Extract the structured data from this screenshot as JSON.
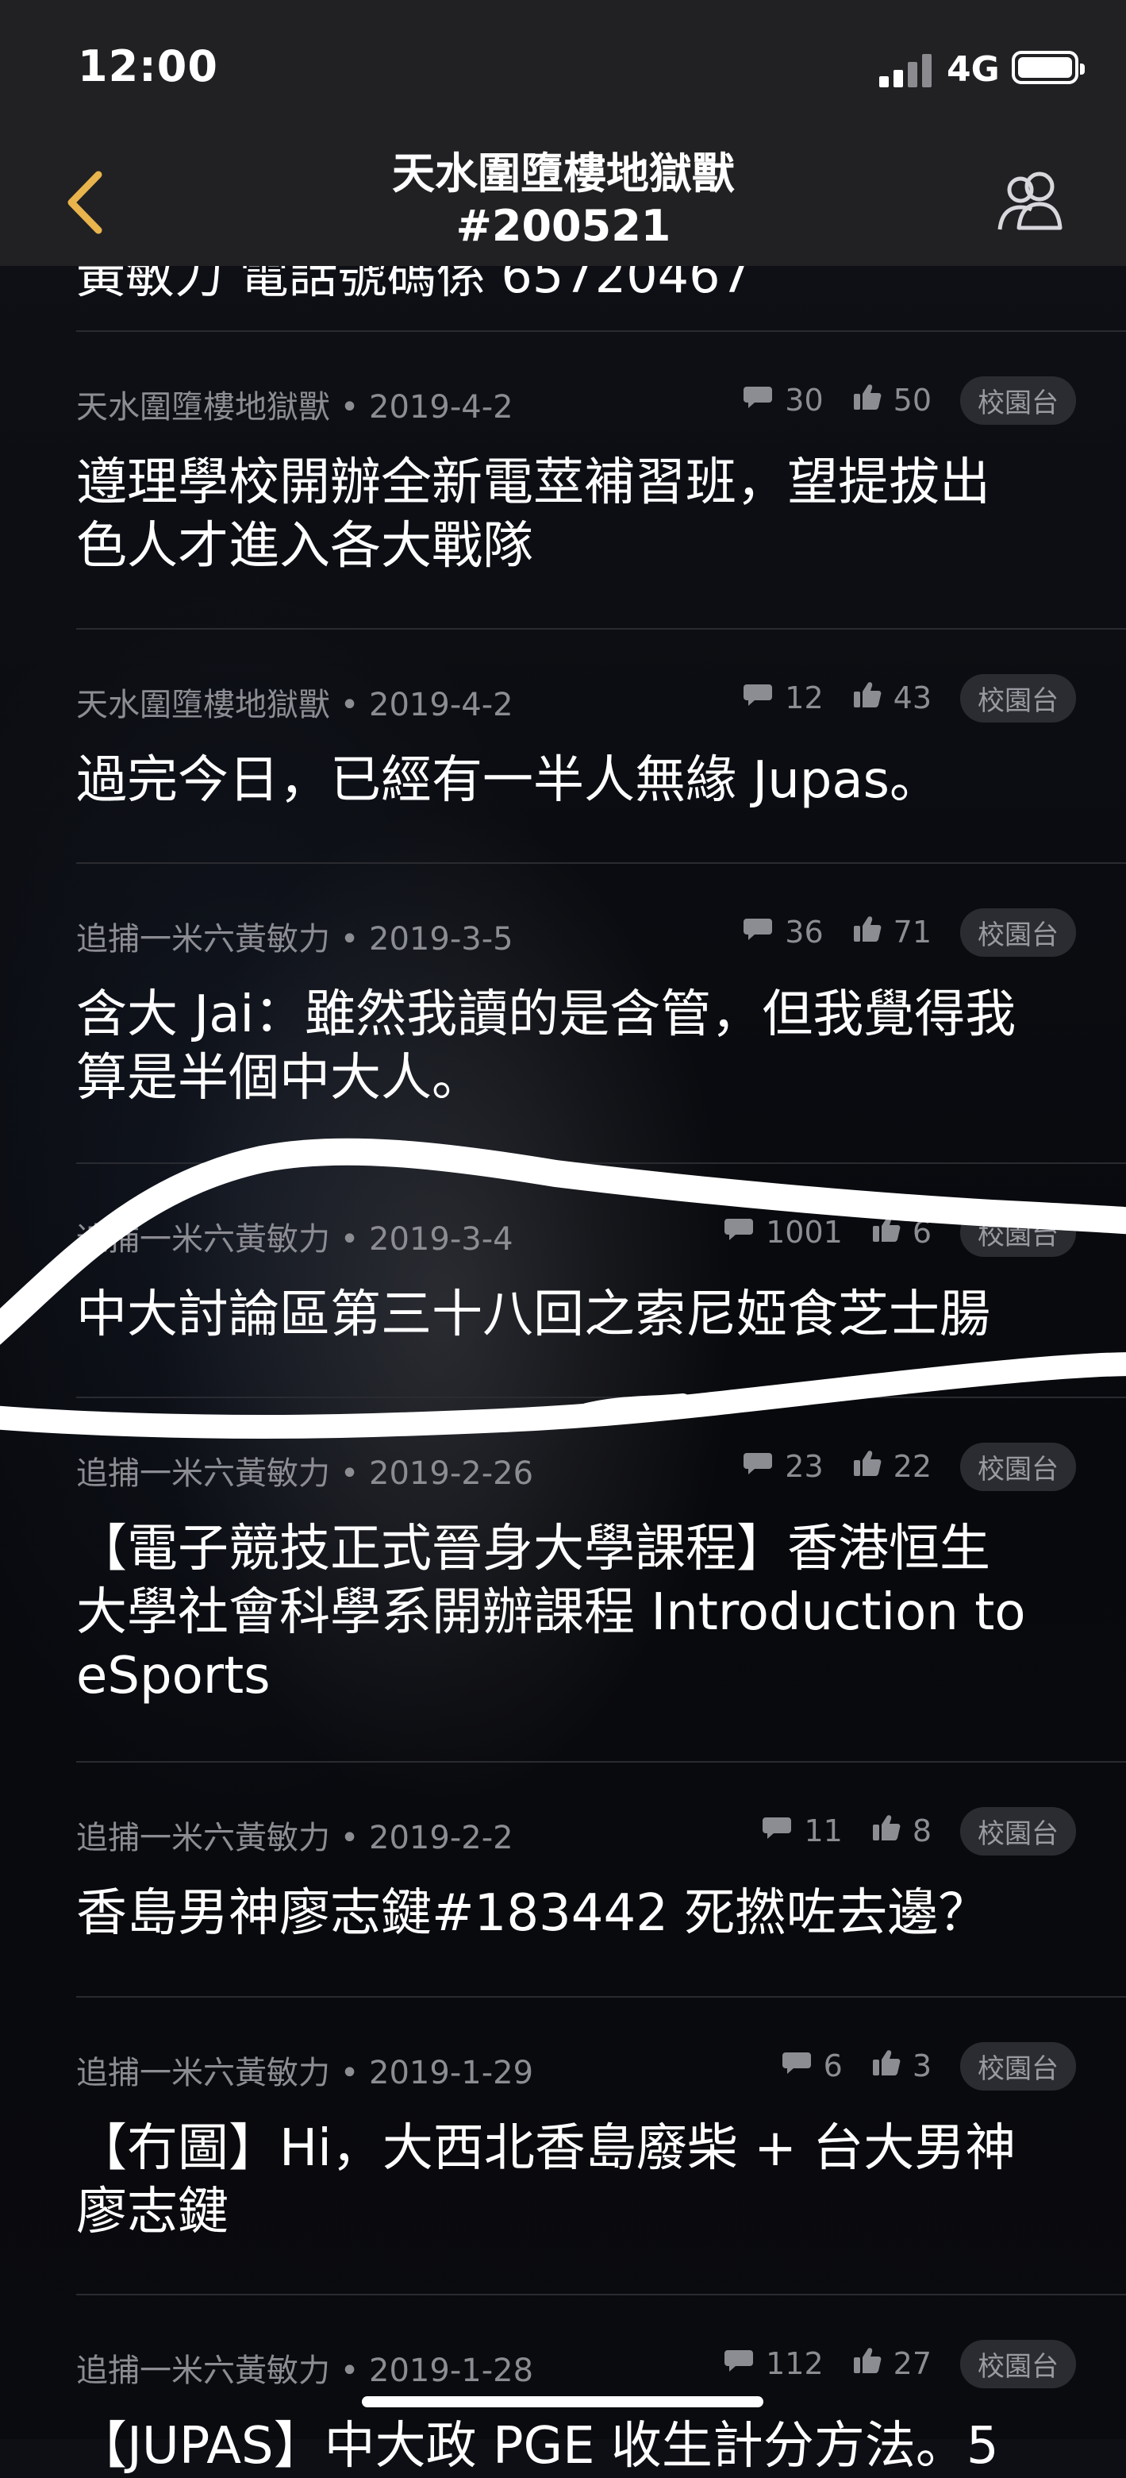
{
  "status_bar": {
    "time": "12:00",
    "network": "4G"
  },
  "header": {
    "title_line1": "天水圍墮樓地獄獸",
    "title_line2": "#200521"
  },
  "partial_top_text": "黃敏力 電話號碼係 65720467",
  "posts": [
    {
      "author": "天水圍墮樓地獄獸",
      "date": "2019-4-2",
      "comments": "30",
      "likes": "50",
      "tag": "校園台",
      "title_lines": [
        "遵理學校開辦全新電莖補習班，望提拔出",
        "色人才進入各大戰隊"
      ]
    },
    {
      "author": "天水圍墮樓地獄獸",
      "date": "2019-4-2",
      "comments": "12",
      "likes": "43",
      "tag": "校園台",
      "title_lines": [
        "過完今日，已經有一半人無緣 Jupas。"
      ]
    },
    {
      "author": "追捕一米六黃敏力",
      "date": "2019-3-5",
      "comments": "36",
      "likes": "71",
      "tag": "校園台",
      "title_lines": [
        "含大 Jai：雖然我讀的是含管，但我覺得我",
        "算是半個中大人。"
      ]
    },
    {
      "author": "追捕一米六黃敏力",
      "date": "2019-3-4",
      "comments": "1001",
      "likes": "6",
      "tag": "校園台",
      "title_lines": [
        "中大討論區第三十八回之索尼婭食芝士腸"
      ]
    },
    {
      "author": "追捕一米六黃敏力",
      "date": "2019-2-26",
      "comments": "23",
      "likes": "22",
      "tag": "校園台",
      "title_lines": [
        "【電子競技正式晉身大學課程】香港恒生",
        "大學社會科學系開辦課程 Introduction to",
        "eSports"
      ]
    },
    {
      "author": "追捕一米六黃敏力",
      "date": "2019-2-2",
      "comments": "11",
      "likes": "8",
      "tag": "校園台",
      "title_lines": [
        "香島男神廖志鍵#183442 死撚咗去邊？"
      ]
    },
    {
      "author": "追捕一米六黃敏力",
      "date": "2019-1-29",
      "comments": "6",
      "likes": "3",
      "tag": "校園台",
      "title_lines": [
        "【冇圖】Hi，大西北香島廢柴 + 台大男神",
        "廖志鍵"
      ]
    },
    {
      "author": "追捕一米六黃敏力",
      "date": "2019-1-28",
      "comments": "112",
      "likes": "27",
      "tag": "校園台",
      "title_lines": [
        "【JUPAS】中大政 PGE 收生計分方法。5"
      ]
    }
  ],
  "separator": " • ",
  "colors": {
    "accent": "#e9b44c",
    "background": "#0d0f14",
    "bar": "#212124",
    "muted_text": "#8c8c93"
  },
  "icons": {
    "back": "chevron-left-icon",
    "members": "group-icon",
    "comments": "speech-bubble-icon",
    "likes": "thumbs-up-icon"
  }
}
